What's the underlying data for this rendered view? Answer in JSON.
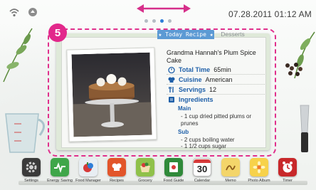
{
  "status": {
    "clock": "07.28.2011 01:12 AM",
    "icons": [
      "wifi-icon",
      "connection-icon"
    ],
    "page_dots": 4,
    "active_dot": 3
  },
  "widget": {
    "badge": "5",
    "tabs": {
      "today": "★ Today Recipe ★",
      "desserts": "Desserts"
    },
    "recipe": {
      "title": "Grandma Hannah's Plum Spice Cake",
      "total_time_label": "Total Time",
      "total_time": "65min",
      "cuisine_label": "Cuisine",
      "cuisine": "American",
      "servings_label": "Servings",
      "servings": "12",
      "ingredients_label": "Ingredients",
      "main_label": "Main",
      "main_item": "- 1 cup dried pitted plums or prunes",
      "sub_label": "Sub",
      "sub_items": [
        "- 2 cups boiling water",
        "- 1 1/2 cups sugar"
      ]
    }
  },
  "dock": {
    "apps": [
      {
        "label": "Settings",
        "icon": "settings-icon"
      },
      {
        "label": "Energy Saving",
        "icon": "energy-saving-icon"
      },
      {
        "label": "Food Manager",
        "icon": "food-manager-icon"
      },
      {
        "label": "Recipes",
        "icon": "recipes-icon"
      },
      {
        "label": "Grocery",
        "icon": "grocery-icon"
      },
      {
        "label": "Food Guide",
        "icon": "food-guide-icon"
      },
      {
        "label": "Calendar",
        "icon": "calendar-icon",
        "day": "30"
      },
      {
        "label": "Memo",
        "icon": "memo-icon"
      },
      {
        "label": "Photo Album",
        "icon": "photo-album-icon"
      },
      {
        "label": "Timer",
        "icon": "timer-icon"
      }
    ]
  },
  "colors": {
    "accent": "#2f7ed8",
    "highlight": "#e0308c",
    "heading": "#1e5fa8"
  }
}
